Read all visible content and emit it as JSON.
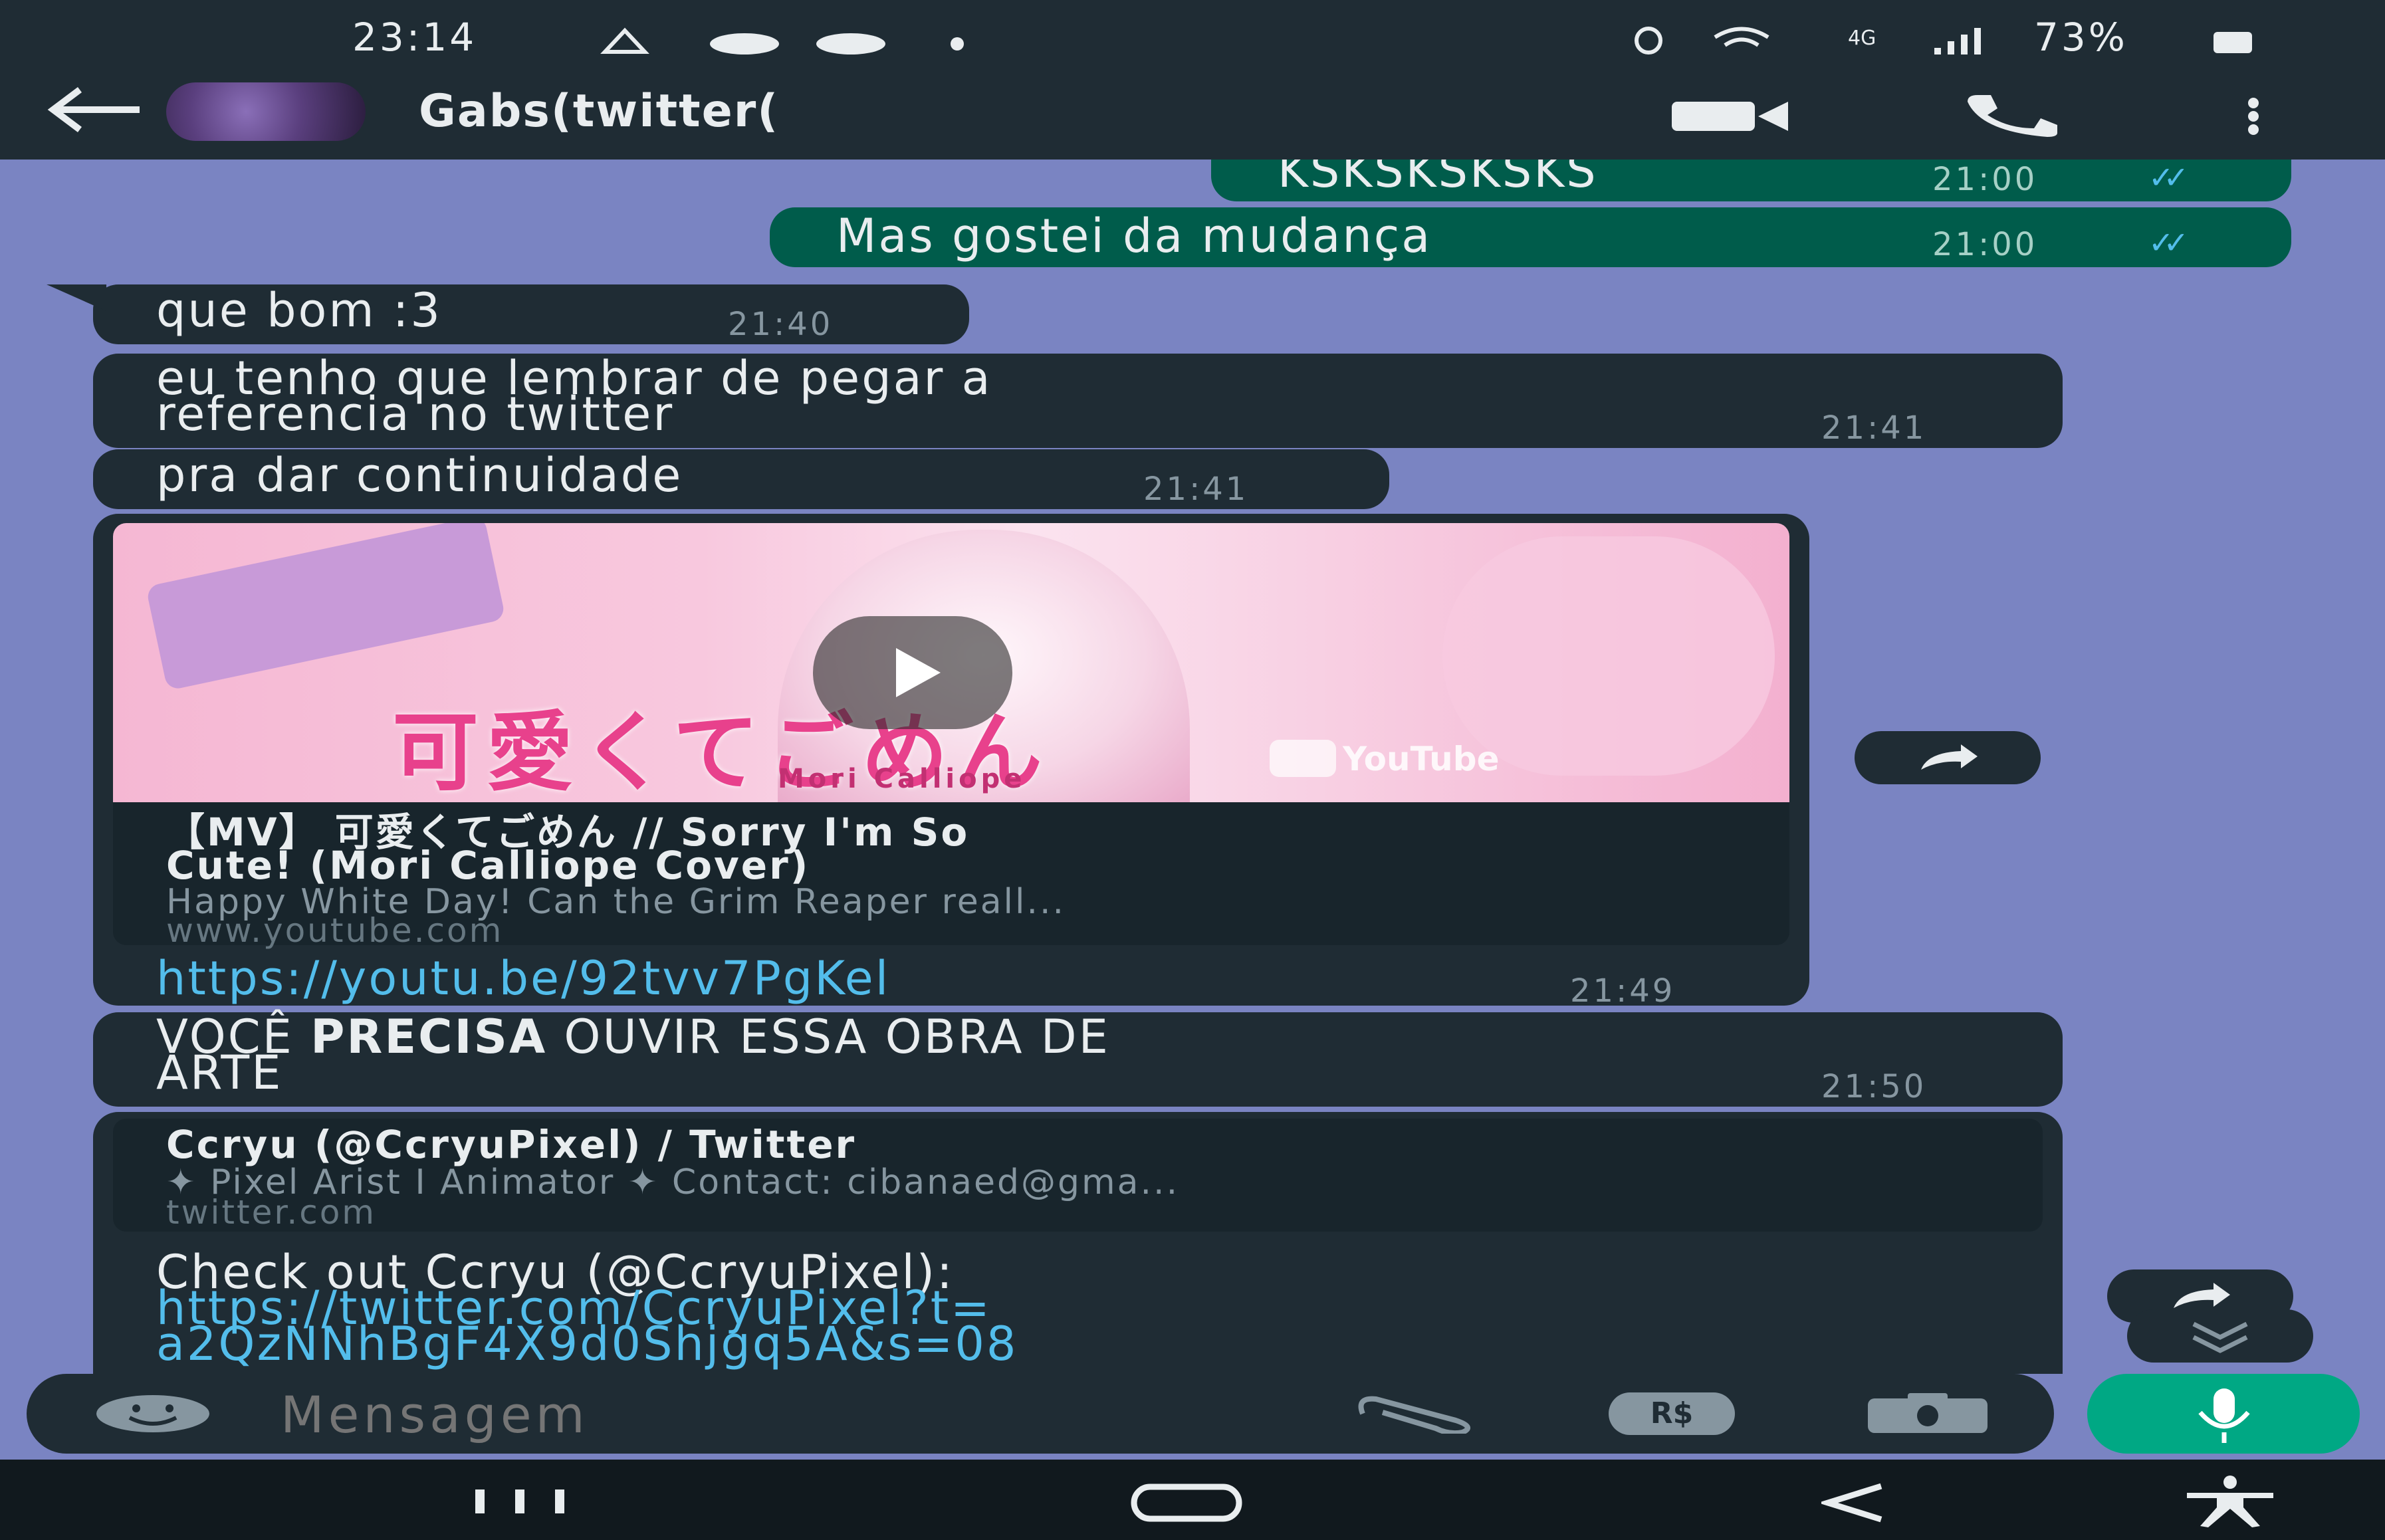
{
  "status": {
    "time": "23:14",
    "battery": "73%",
    "network": "4G"
  },
  "header": {
    "contact_name": "Gabs(twitter(",
    "icons": [
      "back-arrow-icon",
      "video-call-icon",
      "phone-icon",
      "more-vert-icon"
    ]
  },
  "messages": {
    "m0": {
      "text": "KSKSKSKSKS",
      "time": "21:00"
    },
    "m1": {
      "text": "Mas gostei da mudança",
      "time": "21:00"
    },
    "m2": {
      "text": "que bom :3",
      "time": "21:40"
    },
    "m3": {
      "line1": "eu tenho que lembrar de pegar a",
      "line2": "referencia no twitter",
      "time": "21:41"
    },
    "m4": {
      "text": "pra dar continuidade",
      "time": "21:41"
    },
    "m5": {
      "thumb_text": "可愛くてごめん",
      "thumb_credit": "Mori Calliope",
      "thumb_badge": "YouTube",
      "title1": "【MV】 可愛くてごめん // Sorry I'm So",
      "title2": "Cute! (Mori Calliope Cover)",
      "desc": "Happy White Day! Can the Grim Reaper reall...",
      "host": "www.youtube.com",
      "link": "https://youtu.be/92tvv7PgKel",
      "time": "21:49"
    },
    "m6": {
      "pre": "VOCÊ ",
      "bold": "PRECISA",
      "post": " OUVIR ESSA OBRA DE",
      "line2": "ARTE",
      "time": "21:50"
    },
    "m7": {
      "title": "Ccryu (@CcryuPixel) / Twitter",
      "desc": "✦ Pixel Arist I Animator ✦ Contact: cibanaed@gma...",
      "host": "twitter.com",
      "text": "Check out Ccryu (@CcryuPixel):",
      "link1": "https://twitter.com/CcryuPixel?t=",
      "link2": "a2QzNNhBgF4X9d0Shjgq5A&s=08"
    }
  },
  "input": {
    "placeholder": "Mensagem",
    "payment_label": "R$"
  },
  "colors": {
    "wallpaper": "#7a84c2",
    "incoming": "#1f2c34",
    "outgoing": "#005c4b",
    "link": "#53bdeb",
    "mic": "#00a884"
  }
}
